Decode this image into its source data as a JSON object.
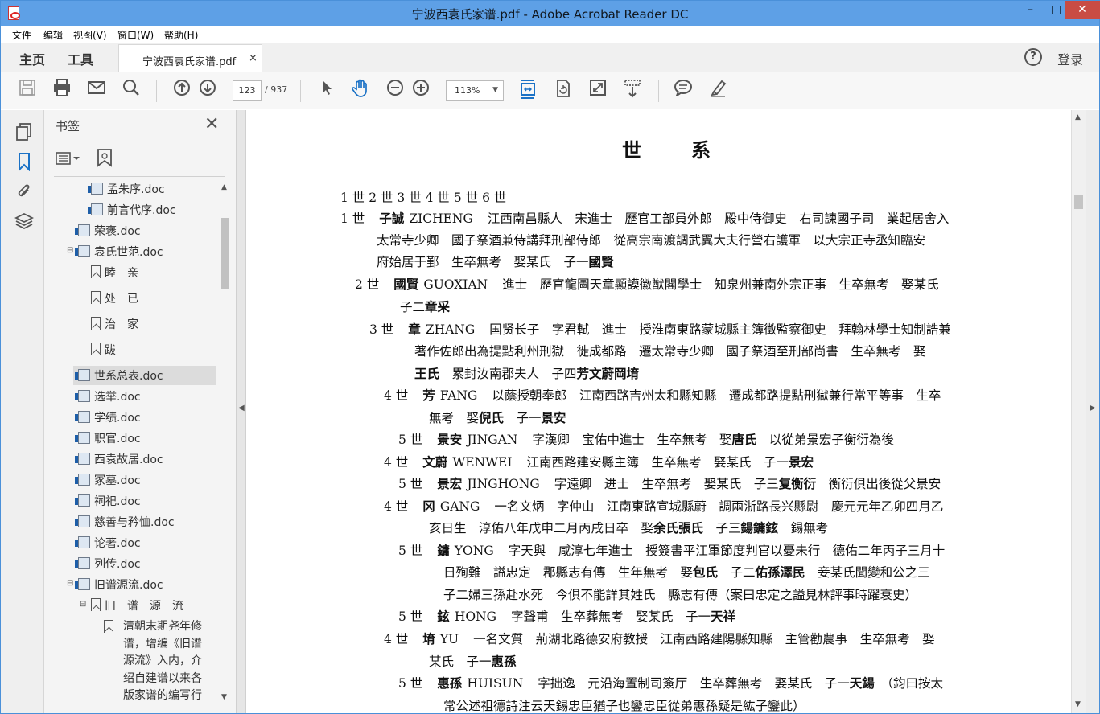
{
  "window": {
    "title": "宁波西袁氏家谱.pdf - Adobe Acrobat Reader DC"
  },
  "menu": [
    "文件",
    "编辑",
    "视图(V)",
    "窗口(W)",
    "帮助(H)"
  ],
  "tabs": {
    "home": "主页",
    "tools": "工具",
    "document": "宁波西袁氏家谱.pdf",
    "close": "×",
    "login": "登录",
    "help": "?"
  },
  "toolbar": {
    "page_current": "123",
    "page_total": "/ 937",
    "zoom": "113%"
  },
  "icons": [
    "save-icon",
    "print-icon",
    "mail-icon",
    "search-icon",
    "page-up-icon",
    "page-down-icon",
    "select-cursor-icon",
    "hand-icon",
    "zoom-out-icon",
    "zoom-in-icon",
    "fit-page-icon",
    "rotate-icon",
    "fullscreen-icon",
    "scroll-mode-icon",
    "comment-icon",
    "highlight-icon"
  ],
  "bookmarks": {
    "title": "书签",
    "items": [
      "孟朱序.doc",
      "前言代序.doc",
      "荣褒.doc",
      "袁氏世范.doc",
      "睦　亲",
      "处　已",
      "治　家",
      "跋",
      "世系总表.doc",
      "选举.doc",
      "学绩.doc",
      "职官.doc",
      "西袁故居.doc",
      "冢墓.doc",
      "祠祀.doc",
      "慈善与矜恤.doc",
      "论著.doc",
      "列传.doc",
      "旧谱源流.doc",
      "旧　谱　源　流"
    ],
    "note_lines": [
      "清朝末期尧年修",
      "谱，增编《旧谱",
      "源流》入内，介",
      "绍自建谱以来各",
      "版家谱的编写行"
    ]
  },
  "doc": {
    "heading": "世系",
    "gen_header": "1 世 2 世 3 世 4 世 5 世 6 世",
    "lines": [
      {
        "g": "1 世",
        "n": "子誠",
        "p": "ZICHENG",
        "t": "江西南昌縣人　宋進士　歷官工部員外郎　殿中侍御史　右司諫國子司　業起居舍入"
      },
      {
        "t": "太常寺少卿　國子祭酒兼侍講拜刑部侍郎　從高宗南渡調武翼大夫行營右護軍　以大宗正寺丞知臨安"
      },
      {
        "t": "府始居于鄞　生卒無考　娶某氏　子一",
        "b": "國賢"
      },
      {
        "g": "2 世",
        "n": "國賢",
        "p": "GUOXIAN",
        "t": "進士　歷官龍圖天章顯謨徽猷閣學士　知泉州兼南外宗正事　生卒無考　娶某氏"
      },
      {
        "t": "子二",
        "b": "章采"
      },
      {
        "g": "3 世",
        "n": "章",
        "p": "ZHANG",
        "t": "国贤长子　字君軾　進士　授淮南東路蒙城縣主簿徵監察御史　拜翰林學士知制誥兼"
      },
      {
        "t": "著作佐郎出為提點利州刑獄　徙成都路　遷太常寺少卿　國子祭酒至刑部尚書　生卒無考　娶"
      },
      {
        "t": "",
        "b": "王氏",
        "t2": "　累封汝南郡夫人　子四",
        "b2": "芳文蔚岡堉"
      },
      {
        "g": "4 世",
        "n": "芳",
        "p": "FANG",
        "t": "以蔭授朝奉郎　江南西路吉州太和縣知縣　遷成都路提點刑獄兼行常平等事　生卒"
      },
      {
        "t": "無考　娶",
        "b": "倪氏",
        "t2": "　子一",
        "b2": "景安"
      },
      {
        "g": "5 世",
        "n": "景安",
        "p": "JINGAN",
        "t": "字漢卿　宝佑中進士　生卒無考　娶",
        "b": "唐氏",
        "t2": "　以從弟景宏子衡衍為後"
      },
      {
        "g": "4 世",
        "n": "文蔚",
        "p": "WENWEI",
        "t": "江南西路建安縣主簿　生卒無考　娶某氏　子一",
        "b": "景宏"
      },
      {
        "g": "5 世",
        "n": "景宏",
        "p": "JINGHONG",
        "t": "字遠卿　进士　生卒無考　娶某氏　子三",
        "b": "复衡衍",
        "t2": "　衡衍俱出後從父景安"
      },
      {
        "g": "4 世",
        "n": "冈",
        "p": "GANG",
        "t": "一名文炳　字仲山　江南東路宣城縣蔚　調兩浙路長兴縣尉　慶元元年乙卯四月乙"
      },
      {
        "t": "亥日生　淳佑八年戊申二月丙戌日卒　娶",
        "b": "余氏張氏",
        "t2": "　子三",
        "b2": "鍚鏞鉉",
        "t3": "　錫無考"
      },
      {
        "g": "5 世",
        "n": "鏞",
        "p": "YONG",
        "t": "字天與　咸淳七年進士　授簽書平江軍節度判官以憂未行　德佑二年丙子三月十"
      },
      {
        "t": "日殉難　謚忠定　郡縣志有傳　生年無考　娶",
        "b": "包氏",
        "t2": "　子二",
        "b2": "佑孫澤民",
        "t3": "　妾某氏聞變和公之三"
      },
      {
        "t": "子二婦三孫赴水死　今俱不能詳其姓氏　縣志有傳（案曰忠定之謚見林評事時躍衰史）"
      },
      {
        "g": "5 世",
        "n": "鉉",
        "p": "HONG",
        "t": "字聲甫　生卒葬無考　娶某氏　子一",
        "b": "天祥"
      },
      {
        "g": "4 世",
        "n": "堉",
        "p": "YU",
        "t": "一名文質　荊湖北路德安府教授　江南西路建陽縣知縣　主管勸農事　生卒無考　娶"
      },
      {
        "t": "某氏　子一",
        "b": "惠孫"
      },
      {
        "g": "5 世",
        "n": "惠孫",
        "p": "HUISUN",
        "t": "字拙逸　元沿海置制司簽厅　生卒葬無考　娶某氏　子一",
        "b": "天鍚",
        "t2": "　（鈞曰按太"
      },
      {
        "t": "常公述祖德詩注云天錫忠臣猶子也鑾忠臣從弟惠孫疑是紘子鑾此）"
      }
    ]
  }
}
